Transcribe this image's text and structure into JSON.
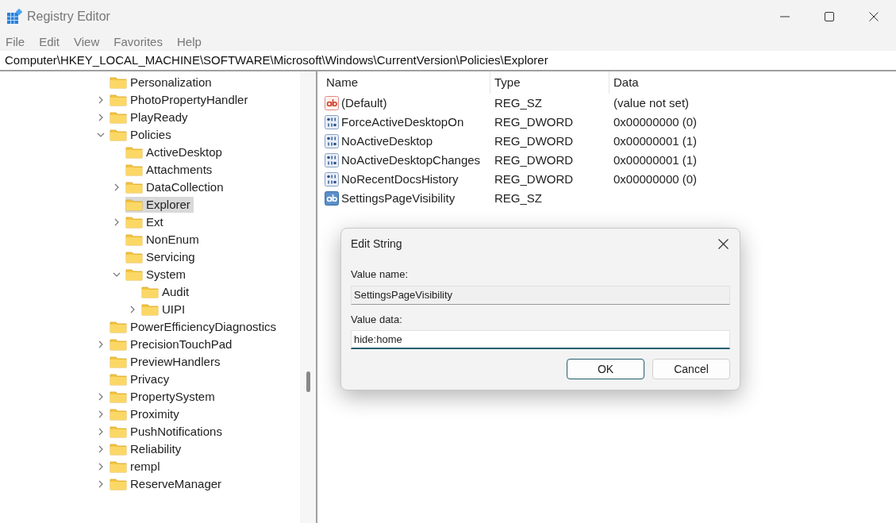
{
  "window": {
    "title": "Registry Editor"
  },
  "menu": [
    "File",
    "Edit",
    "View",
    "Favorites",
    "Help"
  ],
  "address": "Computer\\HKEY_LOCAL_MACHINE\\SOFTWARE\\Microsoft\\Windows\\CurrentVersion\\Policies\\Explorer",
  "tree": [
    {
      "label": "Personalization",
      "kind": "leaf",
      "selected": false
    },
    {
      "label": "PhotoPropertyHandler",
      "kind": "collapsed",
      "selected": false
    },
    {
      "label": "PlayReady",
      "kind": "collapsed",
      "selected": false
    },
    {
      "label": "Policies",
      "kind": "expanded",
      "selected": false,
      "children": [
        {
          "label": "ActiveDesktop",
          "kind": "leaf",
          "selected": false
        },
        {
          "label": "Attachments",
          "kind": "leaf",
          "selected": false
        },
        {
          "label": "DataCollection",
          "kind": "collapsed",
          "selected": false
        },
        {
          "label": "Explorer",
          "kind": "leaf",
          "selected": true
        },
        {
          "label": "Ext",
          "kind": "collapsed",
          "selected": false
        },
        {
          "label": "NonEnum",
          "kind": "leaf",
          "selected": false
        },
        {
          "label": "Servicing",
          "kind": "leaf",
          "selected": false
        },
        {
          "label": "System",
          "kind": "expanded",
          "selected": false,
          "children": [
            {
              "label": "Audit",
              "kind": "leaf",
              "selected": false
            },
            {
              "label": "UIPI",
              "kind": "collapsed",
              "selected": false
            }
          ]
        }
      ]
    },
    {
      "label": "PowerEfficiencyDiagnostics",
      "kind": "leaf",
      "selected": false
    },
    {
      "label": "PrecisionTouchPad",
      "kind": "collapsed",
      "selected": false
    },
    {
      "label": "PreviewHandlers",
      "kind": "leaf",
      "selected": false
    },
    {
      "label": "Privacy",
      "kind": "leaf",
      "selected": false
    },
    {
      "label": "PropertySystem",
      "kind": "collapsed",
      "selected": false
    },
    {
      "label": "Proximity",
      "kind": "collapsed",
      "selected": false
    },
    {
      "label": "PushNotifications",
      "kind": "collapsed",
      "selected": false
    },
    {
      "label": "Reliability",
      "kind": "collapsed",
      "selected": false
    },
    {
      "label": "rempl",
      "kind": "collapsed",
      "selected": false
    },
    {
      "label": "ReserveManager",
      "kind": "collapsed",
      "selected": false
    }
  ],
  "table": {
    "columns": [
      "Name",
      "Type",
      "Data"
    ],
    "rows": [
      {
        "kind": "string",
        "name": "(Default)",
        "type": "REG_SZ",
        "data": "(value not set)"
      },
      {
        "kind": "dword",
        "name": "ForceActiveDesktopOn",
        "type": "REG_DWORD",
        "data": "0x00000000 (0)"
      },
      {
        "kind": "dword",
        "name": "NoActiveDesktop",
        "type": "REG_DWORD",
        "data": "0x00000001 (1)"
      },
      {
        "kind": "dword",
        "name": "NoActiveDesktopChanges",
        "type": "REG_DWORD",
        "data": "0x00000001 (1)"
      },
      {
        "kind": "dword",
        "name": "NoRecentDocsHistory",
        "type": "REG_DWORD",
        "data": "0x00000000 (0)"
      },
      {
        "kind": "string_selected",
        "name": "SettingsPageVisibility",
        "type": "REG_SZ"
      }
    ]
  },
  "dialog": {
    "title": "Edit String",
    "name_label": "Value name:",
    "name_value": "SettingsPageVisibility",
    "data_label": "Value data:",
    "data_value": "hide:home",
    "ok": "OK",
    "cancel": "Cancel"
  }
}
